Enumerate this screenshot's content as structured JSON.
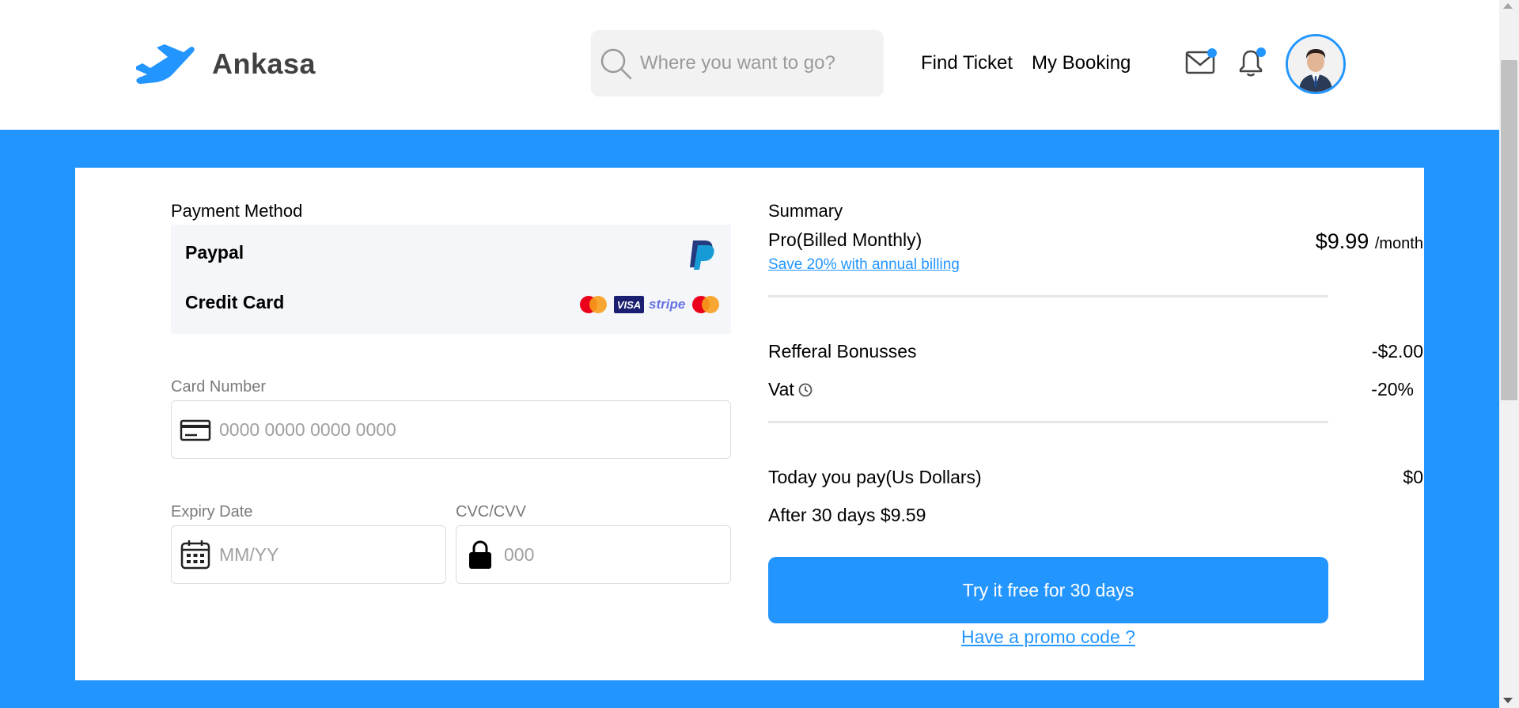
{
  "brand": {
    "name": "Ankasa",
    "color": "#2395ff"
  },
  "search": {
    "placeholder": "Where you want to go?"
  },
  "nav": {
    "find_ticket": "Find Ticket",
    "my_booking": "My Booking"
  },
  "header_icons": [
    "mail-icon",
    "bell-icon",
    "avatar"
  ],
  "payment": {
    "title": "Payment Method",
    "methods": [
      {
        "label": "Paypal",
        "icon": "paypal-icon"
      },
      {
        "label": "Credit Card",
        "logos": [
          "mastercard-icon",
          "VISA",
          "stripe",
          "mastercard-icon"
        ]
      }
    ]
  },
  "form": {
    "card_number_label": "Card Number",
    "card_number_placeholder": "0000 0000 0000 0000",
    "expiry_label": "Expiry Date",
    "expiry_placeholder": "MM/YY",
    "cvc_label": "CVC/CVV",
    "cvc_placeholder": "000"
  },
  "summary": {
    "title": "Summary",
    "plan": "Pro(Billed Monthly)",
    "annual_link": "Save 20% with annual billing",
    "price": "$9.99",
    "price_unit": "/month",
    "referral_label": "Refferal Bonusses",
    "referral_value": "-$2.00",
    "vat_label": "Vat",
    "vat_value": "-20%",
    "today_label": "Today you pay(Us Dollars)",
    "today_value": "$0",
    "after_label": "After 30 days $9.59",
    "cta": "Try it free for 30 days",
    "promo": "Have a promo code ?"
  },
  "colors": {
    "accent": "#2395ff",
    "panel": "#f4f6fa",
    "search_bg": "#f2f2f2"
  }
}
